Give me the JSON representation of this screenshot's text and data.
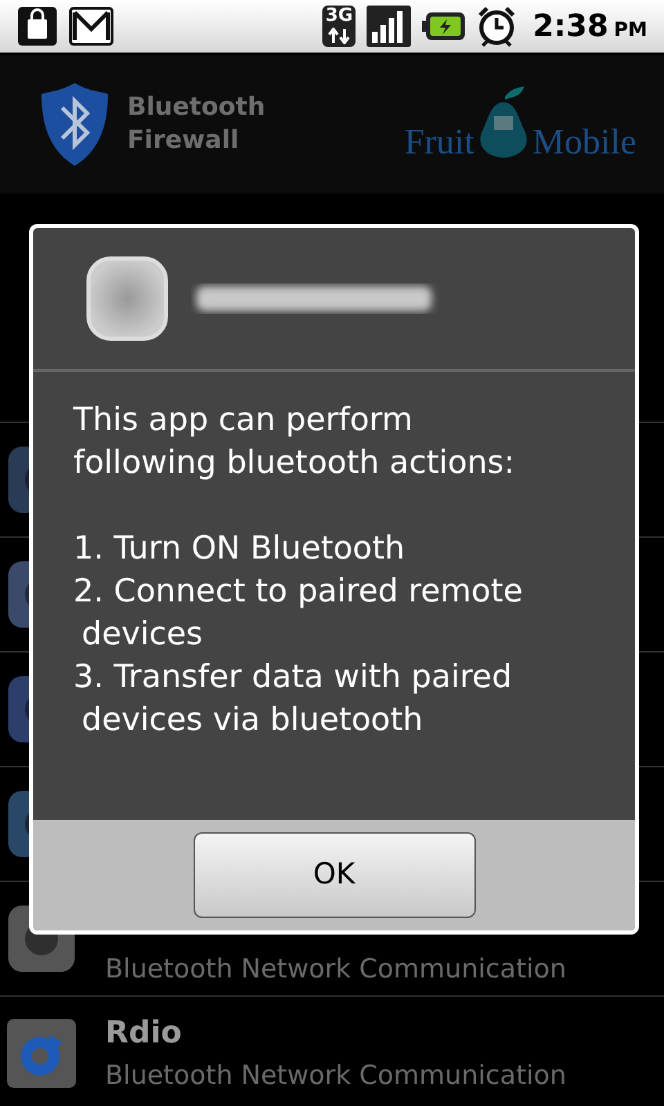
{
  "status_bar": {
    "network": "3G",
    "time": "2:38",
    "ampm": "PM"
  },
  "header": {
    "title": "Bluetooth Firewall",
    "logo_left": "Fruit",
    "logo_right": "Mobile"
  },
  "app_rows": [
    {
      "kind": "covered"
    },
    {
      "kind": "covered"
    },
    {
      "kind": "covered"
    },
    {
      "kind": "covered"
    },
    {
      "kind": "subtitle_only",
      "subtitle": "Bluetooth Network Communication"
    },
    {
      "kind": "full",
      "name": "Rdio",
      "subtitle": "Bluetooth Network Communication"
    }
  ],
  "dialog": {
    "body": "This app can perform following bluetooth actions:",
    "actions": [
      "1. Turn ON Bluetooth",
      "2. Connect to paired remote devices",
      "3. Transfer data with paired devices via bluetooth"
    ],
    "button": "OK"
  }
}
